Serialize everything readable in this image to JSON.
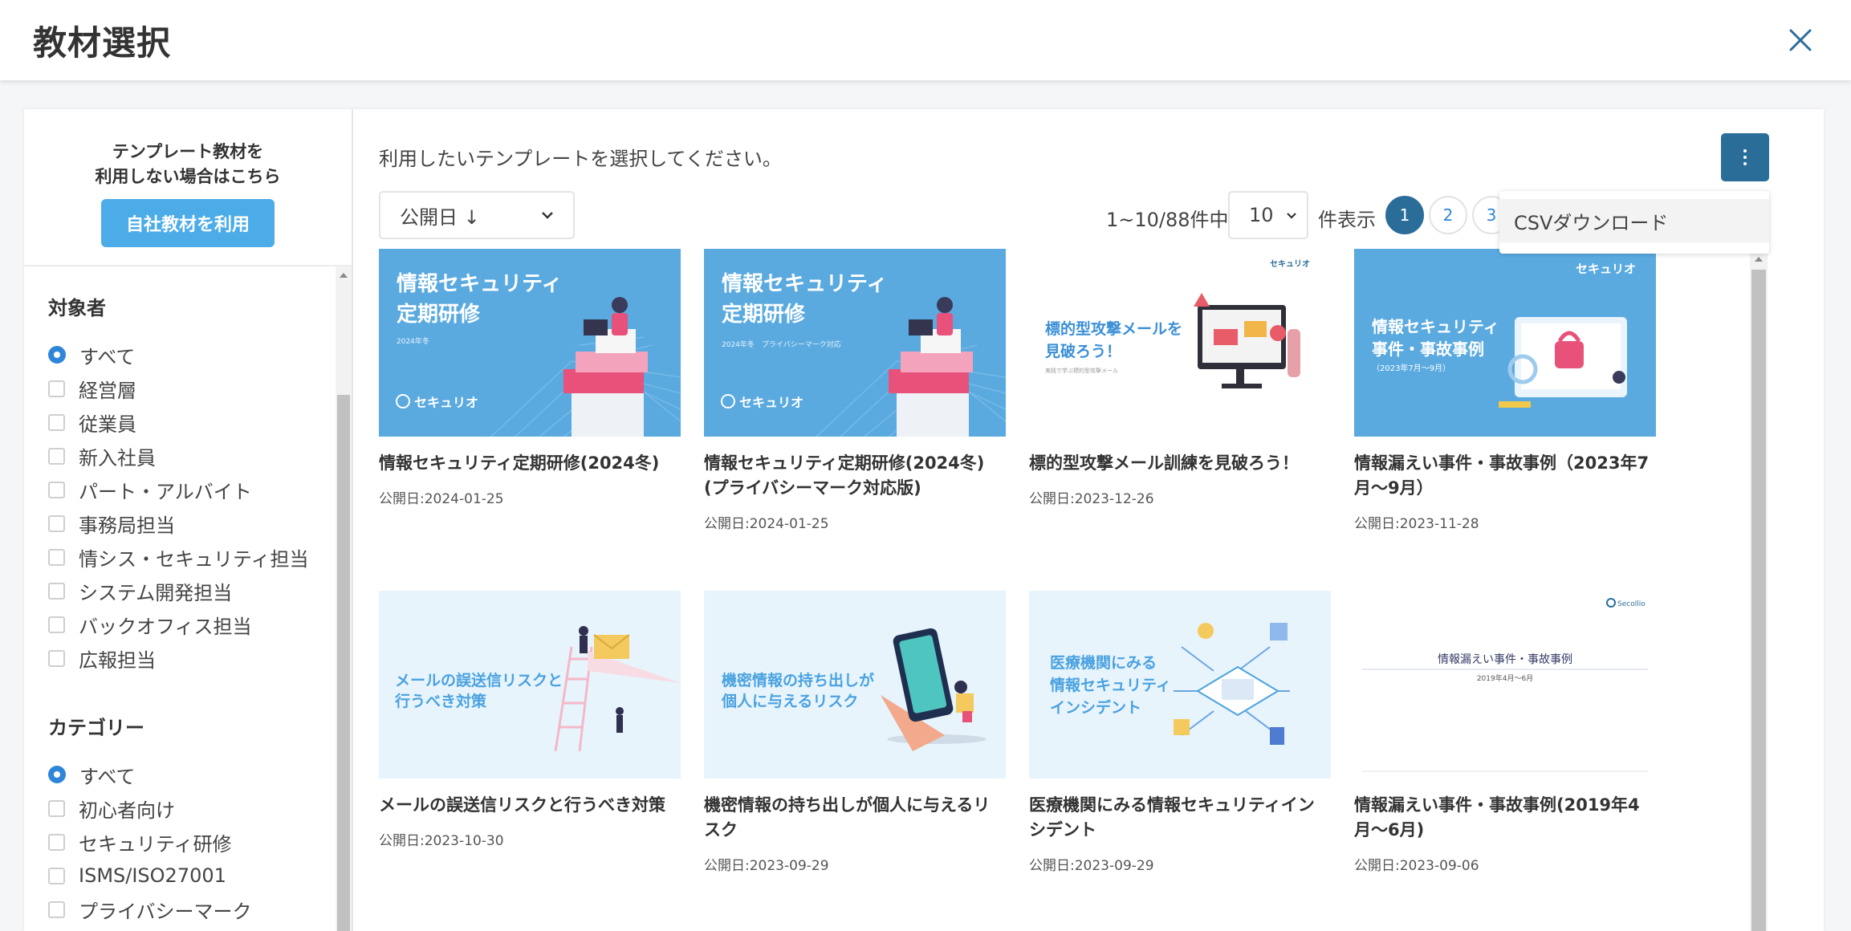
{
  "header": {
    "title": "教材選択",
    "close_icon": "close-icon"
  },
  "sidebar": {
    "note_line1": "テンプレート教材を",
    "note_line2": "利用しない場合はこちら",
    "own_button": "自社教材を利用",
    "audience": {
      "heading": "対象者",
      "items": [
        "すべて",
        "経営層",
        "従業員",
        "新入社員",
        "パート・アルバイト",
        "事務局担当",
        "情シス・セキュリティ担当",
        "システム開発担当",
        "バックオフィス担当",
        "広報担当"
      ],
      "selected": "すべて"
    },
    "category": {
      "heading": "カテゴリー",
      "items": [
        "すべて",
        "初心者向け",
        "セキュリティ研修",
        "ISMS/ISO27001",
        "プライバシーマーク"
      ],
      "selected": "すべて"
    }
  },
  "main": {
    "instruction": "利用したいテンプレートを選択してください。",
    "sort_label": "公開日 ↓",
    "count_text": "1~10/88件中",
    "per_page_value": "10",
    "per_page_suffix": "件表示",
    "pages": [
      "1",
      "2",
      "3"
    ],
    "current_page": "1",
    "menu_icon": "more-vertical-icon",
    "dropdown_items": [
      "CSVダウンロード"
    ]
  },
  "cards": [
    {
      "title": "情報セキュリティ定期研修(2024冬)",
      "date": "公開日:2024-01-25",
      "thumb": {
        "line1": "情報セキュリティ",
        "line2": "定期研修",
        "sub": "2024年冬",
        "brand": "セキュリオ"
      }
    },
    {
      "title": "情報セキュリティ定期研修(2024冬)(プライバシーマーク対応版)",
      "date": "公開日:2024-01-25",
      "thumb": {
        "line1": "情報セキュリティ",
        "line2": "定期研修",
        "sub": "2024年冬　プライバシーマーク対応",
        "brand": "セキュリオ"
      }
    },
    {
      "title": "標的型攻撃メール訓練を見破ろう！",
      "date": "公開日:2023-12-26",
      "thumb": {
        "line1": "標的型攻撃メールを",
        "line2": "見破ろう！",
        "sub": "実践で学ぶ標的型攻撃メール",
        "brand": "セキュリオ"
      }
    },
    {
      "title": "情報漏えい事件・事故事例（2023年7月～9月）",
      "date": "公開日:2023-11-28",
      "thumb": {
        "line1": "情報セキュリティ",
        "line2": "事件・事故事例",
        "sub": "（2023年7月～9月）",
        "brand": "セキュリオ"
      }
    },
    {
      "title": "メールの誤送信リスクと行うべき対策",
      "date": "公開日:2023-10-30",
      "thumb": {
        "line1": "メールの誤送信リスクと",
        "line2": "行うべき対策"
      }
    },
    {
      "title": "機密情報の持ち出しが個人に与えるリスク",
      "date": "公開日:2023-09-29",
      "thumb": {
        "line1": "機密情報の持ち出しが",
        "line2": "個人に与えるリスク"
      }
    },
    {
      "title": "医療機関にみる情報セキュリティインシデント",
      "date": "公開日:2023-09-29",
      "thumb": {
        "line1": "医療機関にみる",
        "line2": "情報セキュリティ",
        "line3": "インシデント"
      }
    },
    {
      "title": "情報漏えい事件・事故事例(2019年4月～6月)",
      "date": "公開日:2023-09-06",
      "thumb": {
        "line1": "情報漏えい事件・事故事例",
        "sub": "2019年4月～6月",
        "brand": "Secollio"
      }
    }
  ],
  "colors": {
    "accent": "#2b6d99",
    "button": "#4cace8",
    "thumb_blue": "#5aaae0",
    "thumb_light": "#e8f4fc",
    "radio": "#2f86d9"
  }
}
